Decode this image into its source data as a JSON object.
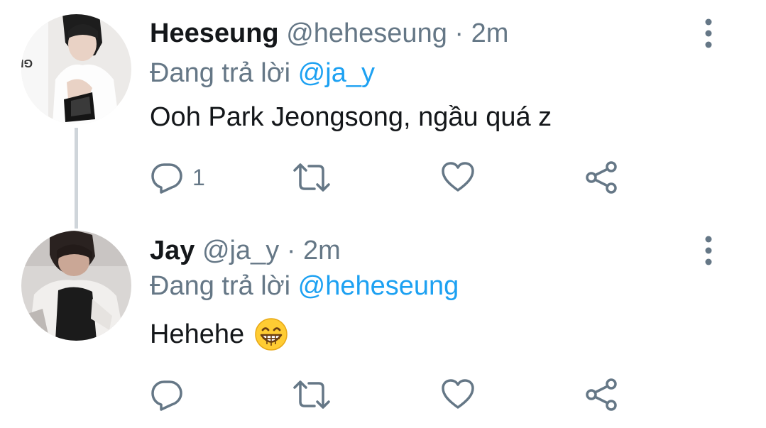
{
  "colors": {
    "text": "#14171a",
    "secondary": "#657786",
    "accent": "#1da1f2",
    "thread_line": "#cfd5da"
  },
  "tweets": [
    {
      "name": "Heeseung",
      "handle": "@heheseung",
      "dot": "·",
      "time": "2m",
      "reply_prefix": "Đang trả lời",
      "reply_to": "@ja_y",
      "text": "Ooh Park Jeongsong, ngầu quá z",
      "emoji": "",
      "reply_count": "1",
      "icons": [
        "reply-icon",
        "retweet-icon",
        "like-icon",
        "share-icon",
        "more-icon"
      ]
    },
    {
      "name": "Jay",
      "handle": "@ja_y",
      "dot": "·",
      "time": "2m",
      "reply_prefix": "Đang trả lời",
      "reply_to": "@heheseung",
      "text": "Hehehe",
      "emoji": "grinning-face-emoji",
      "reply_count": "",
      "icons": [
        "reply-icon",
        "retweet-icon",
        "like-icon",
        "share-icon",
        "more-icon"
      ]
    }
  ]
}
